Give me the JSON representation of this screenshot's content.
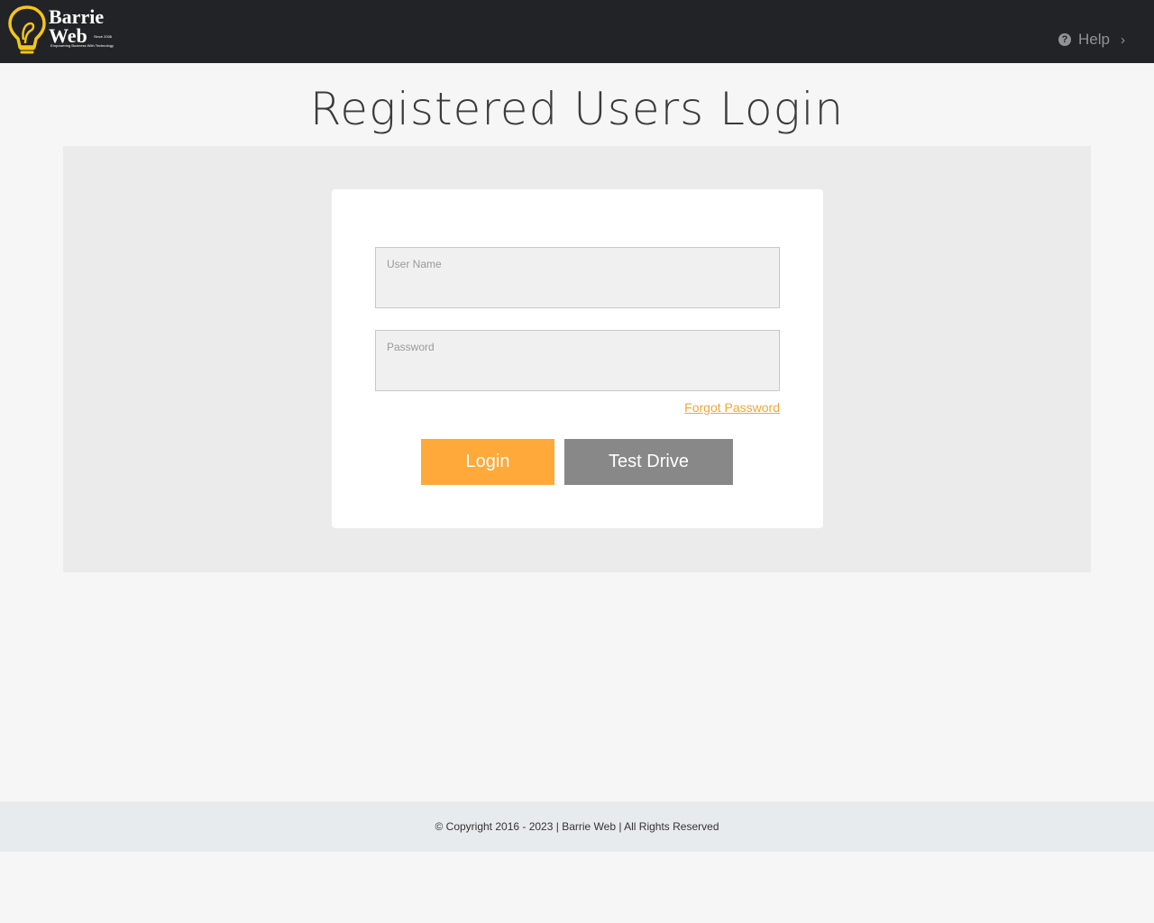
{
  "header": {
    "logo": {
      "line1": "Barrie",
      "line2": "Web",
      "since": "Since 2006",
      "tagline": "Empowering Business With Technology"
    },
    "help_label": "Help",
    "help_icon": "question-circle-icon",
    "chevron_icon": "chevron-right-icon"
  },
  "main": {
    "title": "Registered Users Login",
    "form": {
      "username_label": "User Name",
      "username_value": "",
      "password_label": "Password",
      "password_value": "",
      "forgot_label": "Forgot Password",
      "login_label": "Login",
      "test_drive_label": "Test Drive"
    }
  },
  "footer": {
    "text": "© Copyright 2016 - 2023 | Barrie Web | All Rights Reserved"
  },
  "colors": {
    "header_bg": "#212326",
    "accent": "#ffa93a",
    "secondary_button": "#888888",
    "link": "#f3a436"
  }
}
